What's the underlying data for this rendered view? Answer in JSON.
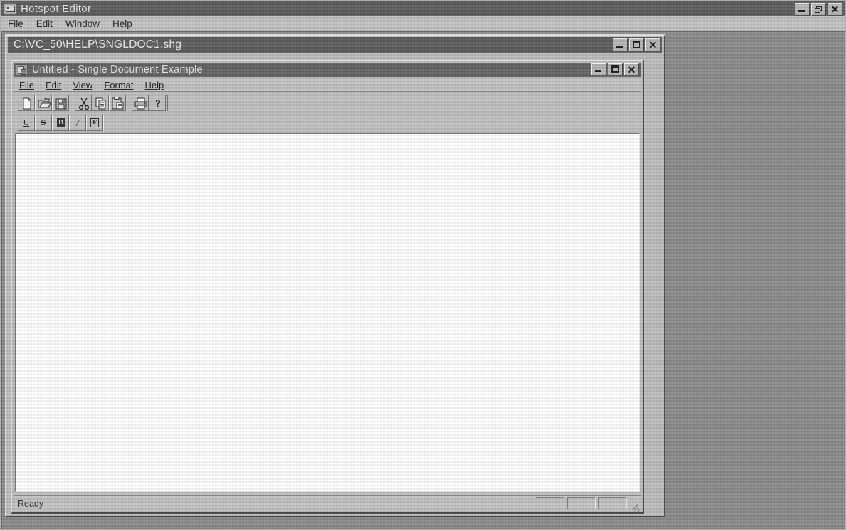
{
  "app": {
    "title": "Hotspot Editor",
    "icon": "hotspot-editor-icon",
    "menus": [
      {
        "label": "File",
        "accel": "F"
      },
      {
        "label": "Edit",
        "accel": "E"
      },
      {
        "label": "Window",
        "accel": "W"
      },
      {
        "label": "Help",
        "accel": "H"
      }
    ],
    "caption_buttons": [
      {
        "name": "minimize-button",
        "glyph": "minimize"
      },
      {
        "name": "restore-button",
        "glyph": "restore"
      },
      {
        "name": "close-button",
        "glyph": "close",
        "char": "✕"
      }
    ]
  },
  "mdi_child": {
    "title": "C:\\VC_50\\HELP\\SNGLDOC1.shg",
    "caption_buttons": [
      {
        "name": "minimize-button",
        "glyph": "minimize"
      },
      {
        "name": "maximize-button",
        "glyph": "maximize"
      },
      {
        "name": "close-button",
        "glyph": "close",
        "char": "✕"
      }
    ]
  },
  "document_window": {
    "title": "Untitled - Single Document Example",
    "icon": "document-app-icon",
    "menus": [
      {
        "label": "File",
        "accel": "F"
      },
      {
        "label": "Edit",
        "accel": "E"
      },
      {
        "label": "View",
        "accel": "V"
      },
      {
        "label": "Format",
        "accel": "o"
      },
      {
        "label": "Help",
        "accel": "H"
      }
    ],
    "caption_buttons": [
      {
        "name": "minimize-button",
        "glyph": "minimize"
      },
      {
        "name": "maximize-button",
        "glyph": "maximize"
      },
      {
        "name": "close-button",
        "glyph": "close",
        "char": "✕"
      }
    ],
    "toolbar_standard": [
      {
        "name": "new-button",
        "icon": "new-document-icon"
      },
      {
        "name": "open-button",
        "icon": "open-folder-icon"
      },
      {
        "name": "save-button",
        "icon": "floppy-disk-icon"
      },
      {
        "type": "separator"
      },
      {
        "name": "cut-button",
        "icon": "scissors-icon"
      },
      {
        "name": "copy-button",
        "icon": "copy-pages-icon"
      },
      {
        "name": "paste-button",
        "icon": "clipboard-paste-icon"
      },
      {
        "type": "separator"
      },
      {
        "name": "print-button",
        "icon": "printer-icon"
      },
      {
        "name": "about-button",
        "icon": "question-mark-icon"
      }
    ],
    "toolbar_format": [
      {
        "name": "underline-button",
        "icon": "underline-icon",
        "label": "U"
      },
      {
        "name": "strikethrough-button",
        "icon": "strikethrough-icon",
        "label": "S"
      },
      {
        "name": "bold-button",
        "icon": "bold-icon",
        "label": "B"
      },
      {
        "name": "italic-button",
        "icon": "italic-icon",
        "label": "/"
      },
      {
        "name": "font-button",
        "icon": "font-icon",
        "label": "F"
      }
    ],
    "client_text": "",
    "status": {
      "message": "Ready",
      "panes": [
        "",
        "",
        ""
      ]
    }
  },
  "colors": {
    "face": "#c0c0c0",
    "active_caption": "#5d5d5d",
    "caption_text": "#e8e8e8",
    "mdi_client": "#8b8b8b",
    "client_white": "#ffffff",
    "desktop": "#9a9a9a"
  }
}
